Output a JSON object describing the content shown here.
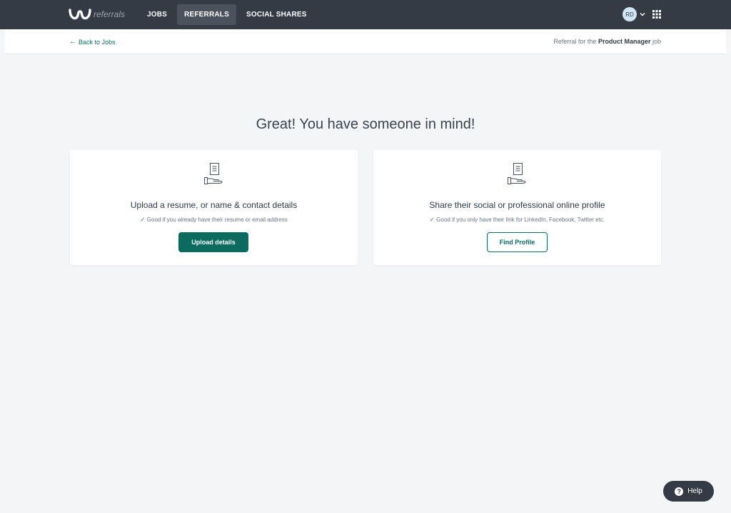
{
  "header": {
    "brand_text": "referrals",
    "logo_icon": "w-logo-icon",
    "nav": [
      {
        "label": "JOBS",
        "active": false
      },
      {
        "label": "REFERRALS",
        "active": true
      },
      {
        "label": "SOCIAL SHARES",
        "active": false
      }
    ],
    "user_initials": "RD",
    "accent": "#343b45"
  },
  "subheader": {
    "back_label": "Back to Jobs",
    "referral_prefix": "Referral for the",
    "job_title": "Product Manager",
    "referral_suffix": "job"
  },
  "main": {
    "headline": "Great! You have someone in mind!",
    "cards": [
      {
        "icon": "hand-document-icon",
        "title": "Upload a resume, or name & contact details",
        "note": "Good if you already have their resume or email address",
        "button_label": "Upload details"
      },
      {
        "icon": "hand-document-icon",
        "title": "Share their social or professional online profile",
        "note": "Good if you only have their link for LinkedIn, Facebook, Twitter etc.",
        "button_label": "Find Profile"
      }
    ]
  },
  "help": {
    "label": "Help"
  },
  "colors": {
    "primary": "#0b6b5e",
    "background": "#f4f5f7"
  }
}
